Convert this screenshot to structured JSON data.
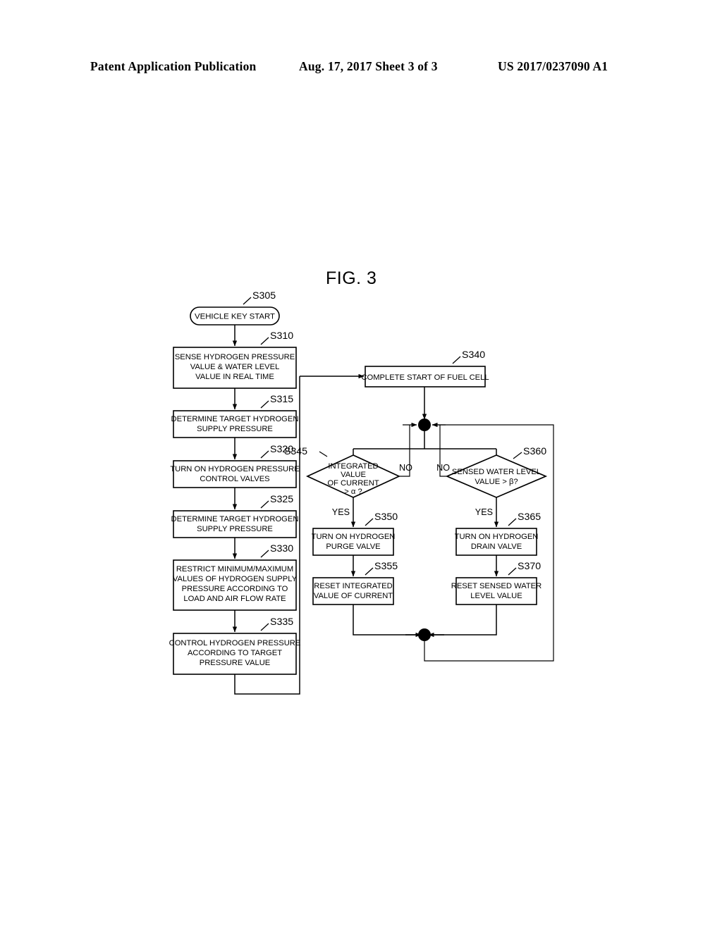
{
  "header": {
    "left": "Patent Application Publication",
    "middle": "Aug. 17, 2017  Sheet 3 of 3",
    "right": "US 2017/0237090 A1"
  },
  "figure": {
    "title": "FIG. 3"
  },
  "flowchart": {
    "terminator": {
      "id": "S305",
      "label": "VEHICLE KEY START"
    },
    "steps": [
      {
        "id": "S310",
        "lines": [
          "SENSE HYDROGEN PRESSURE",
          "VALUE & WATER LEVEL",
          "VALUE IN REAL TIME"
        ]
      },
      {
        "id": "S315",
        "lines": [
          "DETERMINE TARGET HYDROGEN",
          "SUPPLY PRESSURE"
        ]
      },
      {
        "id": "S320",
        "lines": [
          "TURN ON HYDROGEN PRESSURE",
          "CONTROL VALVES"
        ]
      },
      {
        "id": "S325",
        "lines": [
          "DETERMINE TARGET HYDROGEN",
          "SUPPLY PRESSURE"
        ]
      },
      {
        "id": "S330",
        "lines": [
          "RESTRICT MINIMUM/MAXIMUM",
          "VALUES OF HYDROGEN SUPPLY",
          "PRESSURE ACCORDING TO",
          "LOAD AND AIR FLOW RATE"
        ]
      },
      {
        "id": "S335",
        "lines": [
          "CONTROL HYDROGEN PRESSURE",
          "ACCORDING TO TARGET",
          "PRESSURE VALUE"
        ]
      },
      {
        "id": "S340",
        "lines": [
          "COMPLETE START OF FUEL CELL"
        ]
      },
      {
        "id": "S350",
        "lines": [
          "TURN ON HYDROGEN",
          "PURGE VALVE"
        ]
      },
      {
        "id": "S355",
        "lines": [
          "RESET INTEGRATED",
          "VALUE OF CURRENT"
        ]
      },
      {
        "id": "S365",
        "lines": [
          "TURN ON HYDROGEN",
          "DRAIN VALVE"
        ]
      },
      {
        "id": "S370",
        "lines": [
          "RESET SENSED WATER",
          "LEVEL VALUE"
        ]
      }
    ],
    "decisions": [
      {
        "id": "S345",
        "lines": [
          "INTEGRATED",
          "VALUE",
          "OF CURRENT",
          "> α ?"
        ],
        "yes_label": "YES",
        "no_label": "NO"
      },
      {
        "id": "S360",
        "lines": [
          "SENSED WATER LEVEL",
          "VALUE > β?"
        ],
        "yes_label": "YES",
        "no_label": "NO"
      }
    ]
  },
  "colors": {
    "ink": "#000000",
    "paper": "#ffffff"
  }
}
